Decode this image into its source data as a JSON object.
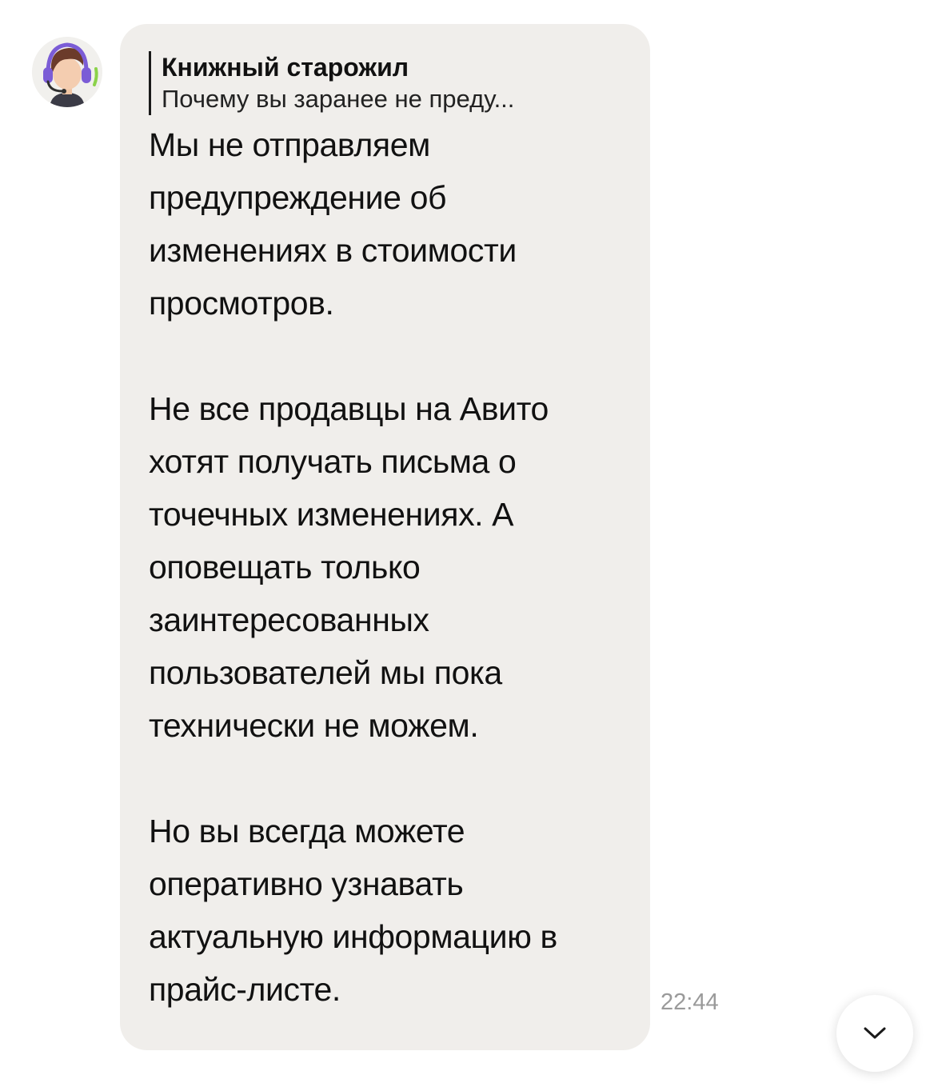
{
  "message": {
    "reply": {
      "author": "Книжный старожил",
      "quote": "Почему вы заранее не преду..."
    },
    "paragraphs": [
      [
        "Мы не отправляем",
        "предупреждение об",
        "изменениях в стоимости",
        "просмотров."
      ],
      [
        "Не все продавцы на Авито",
        "хотят получать письма о",
        "точечных изменениях. А",
        "оповещать только",
        "заинтересованных",
        "пользователей мы пока",
        "технически не можем."
      ],
      [
        "Но вы всегда можете",
        "оперативно узнавать",
        "актуальную информацию в",
        "прайс-листе."
      ]
    ],
    "time": "22:44"
  },
  "icons": {
    "avatar": "support-agent-avatar",
    "scroll_down": "chevron-down-icon"
  },
  "colors": {
    "bubble": "#f0eeeb",
    "text": "#111111",
    "time": "#9a9a9a",
    "headset": "#7b5cd6",
    "mic_accent": "#8bd24a"
  }
}
